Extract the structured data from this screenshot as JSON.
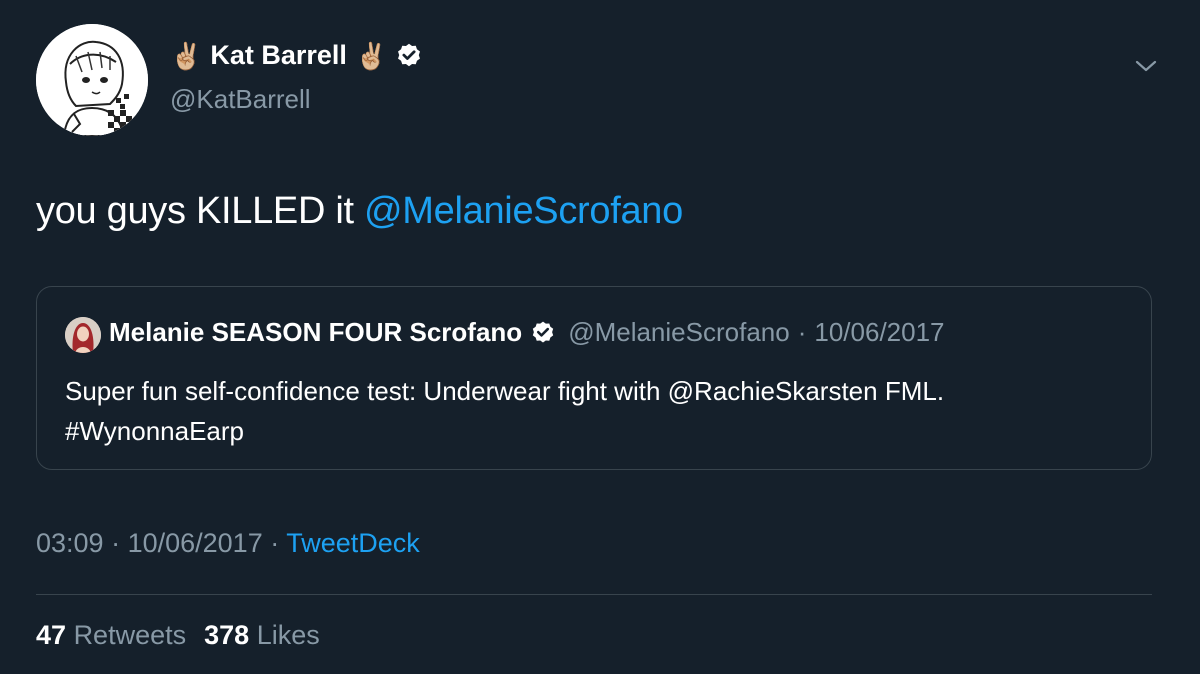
{
  "author": {
    "emoji_left": "✌🏼",
    "name": "Kat Barrell",
    "emoji_right": "✌🏼",
    "handle": "@KatBarrell",
    "verified_icon": "verified-badge-icon"
  },
  "tweet": {
    "text": "you guys KILLED it ",
    "mention": "@MelanieScrofano"
  },
  "quoted": {
    "name": "Melanie SEASON FOUR Scrofano",
    "handle": "@MelanieScrofano",
    "separator": "·",
    "date": "10/06/2017",
    "body_prefix": "Super fun self-confidence test: Underwear fight with ",
    "body_mention": "@RachieSkarsten",
    "body_suffix": " FML.",
    "hashtag": "#WynonnaEarp"
  },
  "meta": {
    "time": "03:09",
    "sep1": " · ",
    "date": "10/06/2017",
    "sep2": " · ",
    "source": "TweetDeck"
  },
  "stats": {
    "retweets_count": "47",
    "retweets_label": "Retweets",
    "likes_count": "378",
    "likes_label": "Likes"
  },
  "colors": {
    "background": "#15202b",
    "link": "#1da1f2",
    "secondary_text": "#8899a6",
    "border": "#38444d"
  }
}
